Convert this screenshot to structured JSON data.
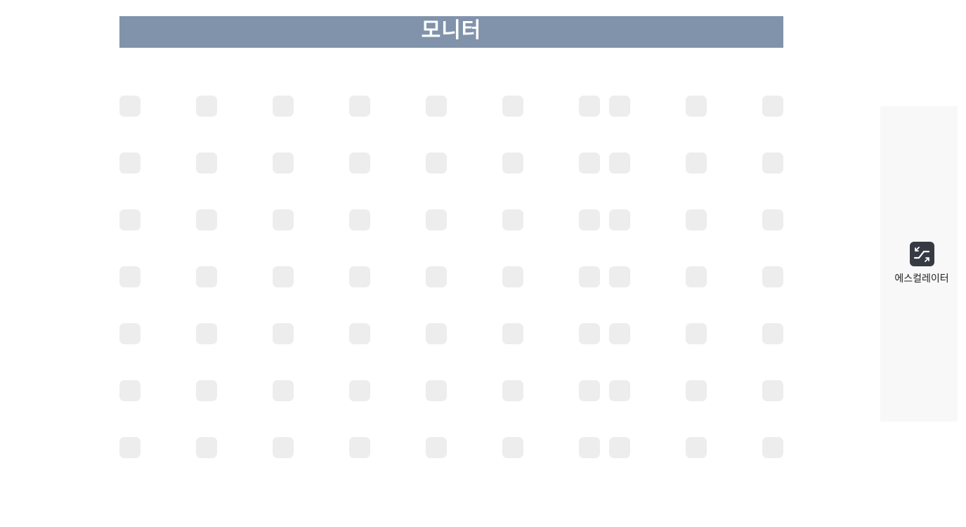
{
  "header": {
    "title": "모니터"
  },
  "seat_grid": {
    "rows": 7,
    "columns": 10
  },
  "side_panel": {
    "escalator": {
      "icon": "escalator-icon",
      "label": "에스컬레이터"
    }
  },
  "colors": {
    "header_bg": "#8193ab",
    "header_text": "#ffffff",
    "seat": "#ededed",
    "side_panel_bg": "#f8f8f8",
    "icon_bg": "#363b43"
  }
}
